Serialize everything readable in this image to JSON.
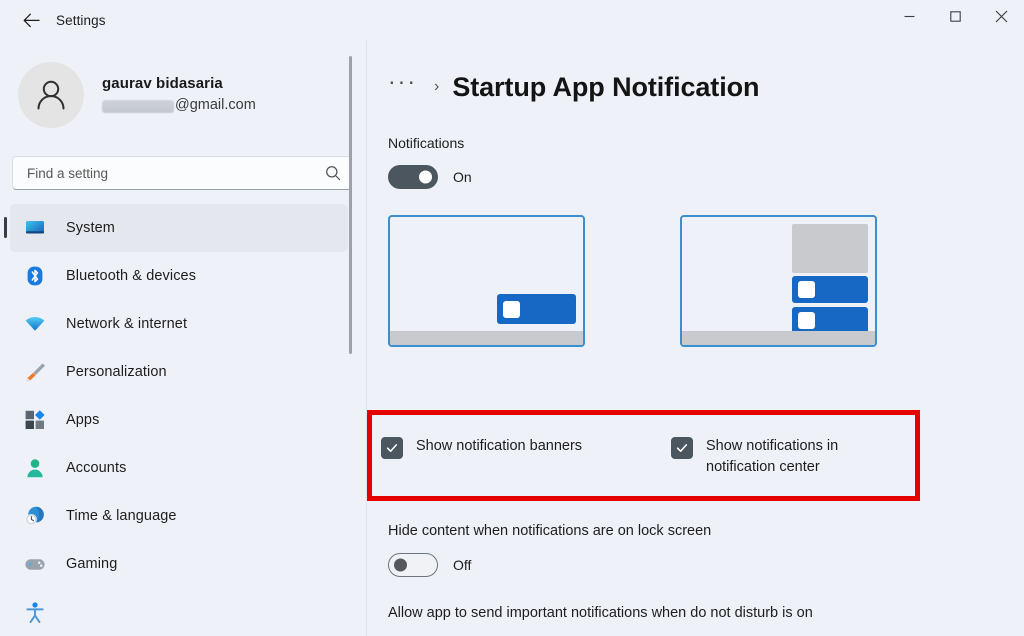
{
  "window": {
    "app_title": "Settings",
    "back_icon": "back-arrow-icon",
    "controls": {
      "minimize": "minimize-icon",
      "maximize": "maximize-icon",
      "close": "close-icon"
    }
  },
  "account": {
    "name": "gaurav bidasaria",
    "email_suffix": "@gmail.com",
    "avatar_icon": "person-avatar-icon"
  },
  "search": {
    "placeholder": "Find a setting",
    "value": "",
    "icon": "search-icon"
  },
  "sidebar": {
    "items": [
      {
        "label": "System",
        "icon": "monitor-icon",
        "active": true
      },
      {
        "label": "Bluetooth & devices",
        "icon": "bluetooth-icon",
        "active": false
      },
      {
        "label": "Network & internet",
        "icon": "wifi-icon",
        "active": false
      },
      {
        "label": "Personalization",
        "icon": "paintbrush-icon",
        "active": false
      },
      {
        "label": "Apps",
        "icon": "apps-blocks-icon",
        "active": false
      },
      {
        "label": "Accounts",
        "icon": "person-icon",
        "active": false
      },
      {
        "label": "Time & language",
        "icon": "globe-clock-icon",
        "active": false
      },
      {
        "label": "Gaming",
        "icon": "gamepad-icon",
        "active": false
      },
      {
        "label": "",
        "icon": "accessibility-icon",
        "active": false
      }
    ],
    "scrollbar": "vertical-scrollbar"
  },
  "main": {
    "breadcrumb_overflow": "···",
    "breadcrumb_separator": "›",
    "title": "Startup App Notification",
    "notifications": {
      "label": "Notifications",
      "toggle_state": "On",
      "toggle_on": true
    },
    "previews": [
      {
        "name": "notification-banner-preview"
      },
      {
        "name": "notification-center-preview"
      }
    ],
    "checkboxes": [
      {
        "label": "Show notification banners",
        "checked": true
      },
      {
        "label": "Show notifications in notification center",
        "checked": true
      }
    ],
    "hide_content": {
      "label": "Hide content when notifications are on lock screen",
      "toggle_state": "Off",
      "toggle_on": false
    },
    "do_not_disturb_label": "Allow app to send important notifications when do not disturb is on"
  },
  "annotation": {
    "highlight_color": "#e60000"
  },
  "colors": {
    "accent_blue": "#1668c4",
    "preview_border": "#3a8fd0",
    "toggle_on": "#4c565f",
    "checkbox_fill": "#4c565f",
    "window_bg": "#eef2f8",
    "taskbar_gray": "#c8cacd"
  }
}
